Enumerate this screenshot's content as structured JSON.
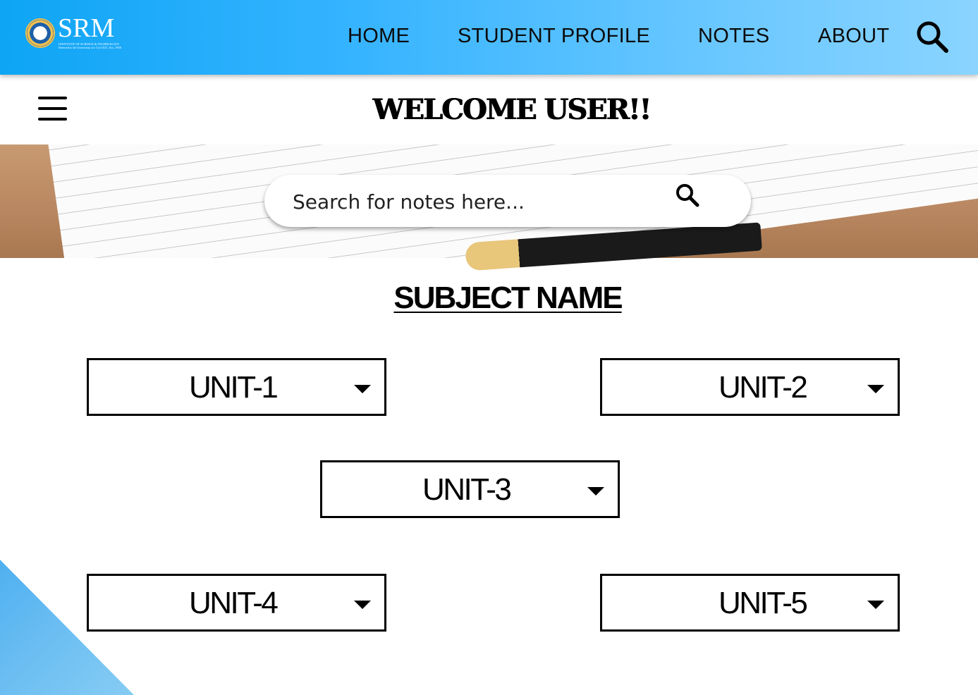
{
  "header": {
    "logo": {
      "name": "SRM",
      "subtitle": "INSTITUTE OF SCIENCE & TECHNOLOGY",
      "tagline": "Deemed to be University u/s 3 of UGC Act, 1956"
    },
    "nav": [
      "HOME",
      "STUDENT PROFILE",
      "NOTES",
      "ABOUT"
    ],
    "search_icon": "search-icon"
  },
  "subbar": {
    "menu_icon": "hamburger-icon",
    "welcome": "WELCOME USER!!"
  },
  "banner": {
    "search_placeholder": "Search for notes here...",
    "search_value": "",
    "search_icon": "search-icon"
  },
  "subject": {
    "title": "SUBJECT NAME",
    "units": [
      "UNIT-1",
      "UNIT-2",
      "UNIT-3",
      "UNIT-4",
      "UNIT-5"
    ]
  },
  "colors": {
    "header_start": "#0ea5f5",
    "header_end": "#8ad4ff",
    "corner_accent": "#6fc0f2"
  }
}
